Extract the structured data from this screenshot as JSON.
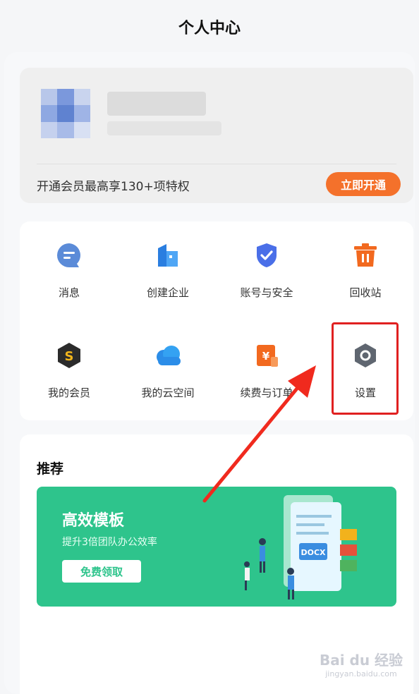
{
  "header": {
    "title": "个人中心"
  },
  "profile": {
    "vip_text": "开通会员最高享130+项特权",
    "vip_button": "立即开通"
  },
  "grid": {
    "items": [
      {
        "label": "消息",
        "icon": "message-icon"
      },
      {
        "label": "创建企业",
        "icon": "building-icon"
      },
      {
        "label": "账号与安全",
        "icon": "shield-icon"
      },
      {
        "label": "回收站",
        "icon": "trash-icon"
      },
      {
        "label": "我的会员",
        "icon": "vip-icon"
      },
      {
        "label": "我的云空间",
        "icon": "cloud-icon"
      },
      {
        "label": "续费与订单",
        "icon": "order-icon"
      },
      {
        "label": "设置",
        "icon": "gear-icon"
      }
    ]
  },
  "recommend": {
    "title": "推荐",
    "banner": {
      "title": "高效模板",
      "subtitle": "提升3倍团队办公效率",
      "button": "免费领取",
      "doc_label": "DOCX"
    }
  },
  "watermark": {
    "main": "Bai du 经验",
    "sub": "jingyan.baidu.com"
  },
  "colors": {
    "accent": "#f4712b",
    "banner": "#2ec48c",
    "highlight": "#e02020"
  }
}
